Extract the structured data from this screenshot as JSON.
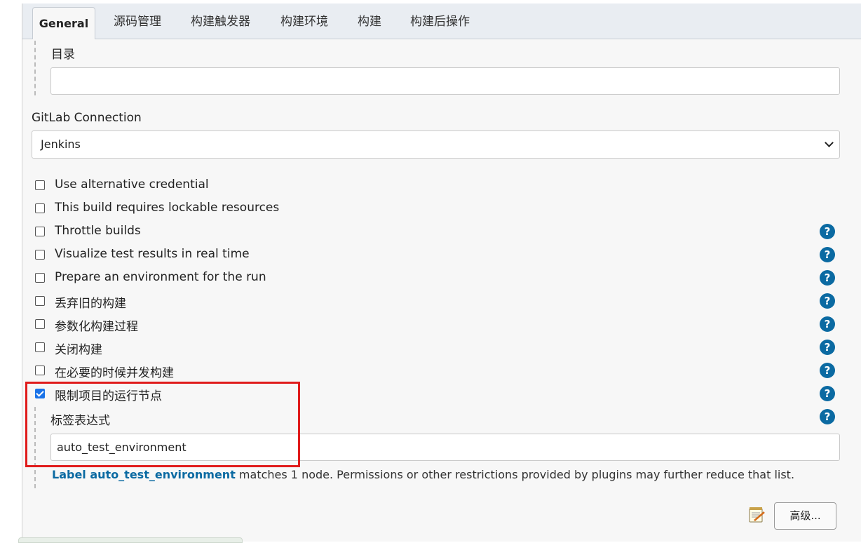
{
  "tabs": [
    {
      "label": "General",
      "active": true
    },
    {
      "label": "源码管理"
    },
    {
      "label": "构建触发器"
    },
    {
      "label": "构建环境"
    },
    {
      "label": "构建"
    },
    {
      "label": "构建后操作"
    }
  ],
  "directory": {
    "label": "目录",
    "value": ""
  },
  "gitlab": {
    "label": "GitLab Connection",
    "selected": "Jenkins"
  },
  "options": [
    {
      "label": "Use alternative credential",
      "checked": false,
      "help": false
    },
    {
      "label": "This build requires lockable resources",
      "checked": false,
      "help": false
    },
    {
      "label": "Throttle builds",
      "checked": false,
      "help": true
    },
    {
      "label": "Visualize test results in real time",
      "checked": false,
      "help": true
    },
    {
      "label": "Prepare an environment for the run",
      "checked": false,
      "help": true
    },
    {
      "label": "丢弃旧的构建",
      "checked": false,
      "help": true
    },
    {
      "label": "参数化构建过程",
      "checked": false,
      "help": true
    },
    {
      "label": "关闭构建",
      "checked": false,
      "help": true
    },
    {
      "label": "在必要的时候并发构建",
      "checked": false,
      "help": true
    },
    {
      "label": "限制项目的运行节点",
      "checked": true,
      "help": true
    }
  ],
  "label_expression": {
    "label": "标签表达式",
    "value": "auto_test_environment",
    "hint_link": "Label auto_test_environment",
    "hint_text": " matches 1 node. Permissions or other restrictions provided by plugins may further reduce that list."
  },
  "help_symbol": "?",
  "advanced_button": "高级...",
  "colors": {
    "accent": "#0b6aa2",
    "highlight": "#e01b1b",
    "checkbox": "#1a73e8"
  }
}
